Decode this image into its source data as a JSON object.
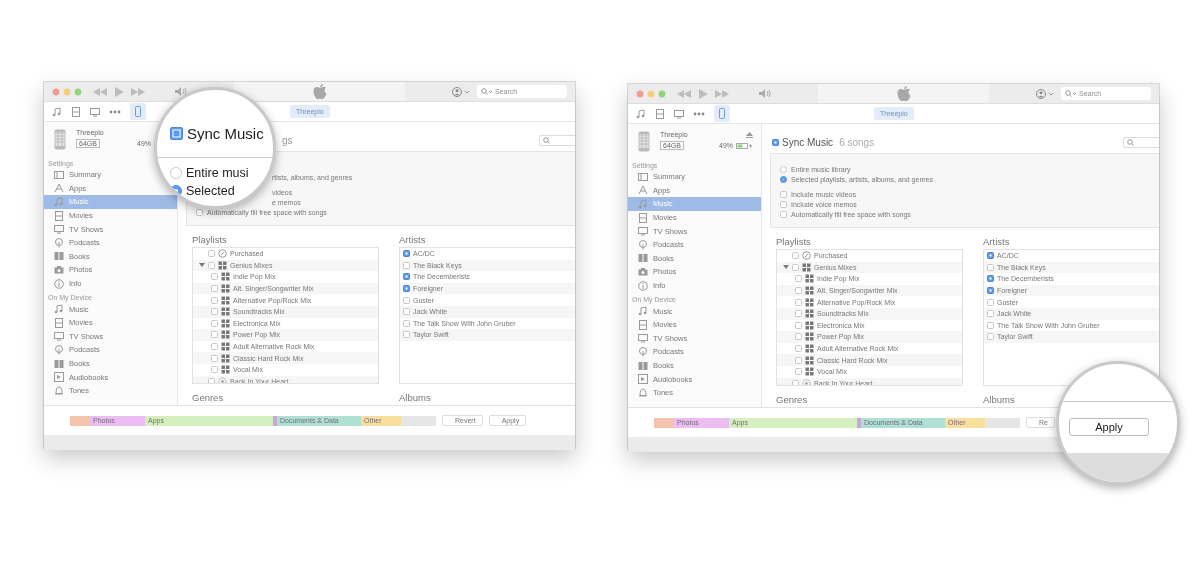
{
  "windows": [
    {
      "titlebar": {
        "search_placeholder": "Search"
      },
      "toolbar": {
        "device_tab": "Threepio"
      },
      "device": {
        "name": "Threepio",
        "capacity": "64GB",
        "battery": "49%",
        "status_icons": false
      },
      "sidebar": {
        "sections": [
          {
            "title": "Settings",
            "items": [
              {
                "label": "Summary",
                "kind": "summary",
                "selected": false
              },
              {
                "label": "Apps",
                "kind": "apps",
                "selected": false
              },
              {
                "label": "Music",
                "kind": "music",
                "selected": true
              },
              {
                "label": "Movies",
                "kind": "movies",
                "selected": false
              },
              {
                "label": "TV Shows",
                "kind": "tv",
                "selected": false
              },
              {
                "label": "Podcasts",
                "kind": "podcasts",
                "selected": false
              },
              {
                "label": "Books",
                "kind": "books",
                "selected": false
              },
              {
                "label": "Photos",
                "kind": "photos",
                "selected": false
              },
              {
                "label": "Info",
                "kind": "info",
                "selected": false
              }
            ]
          },
          {
            "title": "On My Device",
            "items": [
              {
                "label": "Music",
                "kind": "music",
                "selected": false
              },
              {
                "label": "Movies",
                "kind": "movies",
                "selected": false
              },
              {
                "label": "TV Shows",
                "kind": "tv",
                "selected": false
              },
              {
                "label": "Podcasts",
                "kind": "podcasts",
                "selected": false
              },
              {
                "label": "Books",
                "kind": "books",
                "selected": false
              },
              {
                "label": "Audiobooks",
                "kind": "audiobooks",
                "selected": false
              },
              {
                "label": "Tones",
                "kind": "tones",
                "selected": false
              }
            ]
          }
        ]
      },
      "sync": {
        "kind": "covered",
        "title": "gs"
      },
      "options": [
        {
          "kind": "covered"
        },
        {
          "kind": "covered",
          "label": "rtists, albums, and genres"
        },
        {
          "kind": "covered",
          "label": "videos"
        },
        {
          "kind": "covered",
          "label": "e memos"
        },
        {
          "kind": "checkbox",
          "label": "Automatically fill free space with songs",
          "checked": false
        }
      ],
      "playlists": {
        "title": "Playlists",
        "items": [
          {
            "label": "Purchased",
            "kind": "purchased",
            "checked": false
          },
          {
            "label": "Genius Mixes",
            "kind": "genius",
            "checked": false,
            "expanded": true,
            "children": [
              {
                "label": "Indie Pop Mix",
                "kind": "genius",
                "checked": false
              },
              {
                "label": "Alt. Singer/Songwriter Mix",
                "kind": "genius",
                "checked": false
              },
              {
                "label": "Alternative Pop/Rock Mix",
                "kind": "genius",
                "checked": false
              },
              {
                "label": "Soundtracks Mix",
                "kind": "genius",
                "checked": false
              },
              {
                "label": "Electronica Mix",
                "kind": "genius",
                "checked": false
              },
              {
                "label": "Power Pop Mix",
                "kind": "genius",
                "checked": false
              },
              {
                "label": "Adult Alternative Rock Mix",
                "kind": "genius",
                "checked": false
              },
              {
                "label": "Classic Hard Rock Mix",
                "kind": "genius",
                "checked": false
              },
              {
                "label": "Vocal Mix",
                "kind": "genius",
                "checked": false
              }
            ]
          },
          {
            "label": "Back In Your Heart",
            "kind": "smart",
            "checked": false
          }
        ]
      },
      "artists": {
        "title": "Artists",
        "items": [
          {
            "label": "AC/DC",
            "checked": true
          },
          {
            "label": "The Black Keys",
            "checked": false
          },
          {
            "label": "The Decemberists",
            "checked": true
          },
          {
            "label": "Foreigner",
            "checked": true
          },
          {
            "label": "Guster",
            "checked": false
          },
          {
            "label": "Jack White",
            "checked": false
          },
          {
            "label": "The Talk Show With John Gruber",
            "checked": false
          },
          {
            "label": "Taylor Swift",
            "checked": false
          }
        ]
      },
      "sections_below": [
        "Genres",
        "Albums"
      ],
      "capacity": [
        {
          "color": "#f3c4ab"
        },
        {
          "label": "Photos",
          "color": "#ebbdf2"
        },
        {
          "label": "Apps",
          "color": "#d5efbf"
        },
        {
          "color": "#c7a6d8"
        },
        {
          "label": "Documents & Data",
          "color": "#aee0d4"
        },
        {
          "label": "Other",
          "color": "#f9df9e"
        },
        {
          "color": "#e6e6e6"
        }
      ],
      "buttons": [
        "Revert",
        "Apply"
      ],
      "magnifier": {
        "kind": "sync",
        "checkbox": {
          "label": "Sync Music",
          "checked": true
        },
        "radios": [
          {
            "label": "Entire musi",
            "selected": false
          },
          {
            "label": "Selected",
            "selected": true
          }
        ]
      }
    },
    {
      "titlebar": {
        "search_placeholder": "Search"
      },
      "toolbar": {
        "device_tab": "Threepio"
      },
      "device": {
        "name": "Threepio",
        "capacity": "64GB",
        "battery": "49%",
        "status_icons": true
      },
      "sidebar": {
        "sections": [
          {
            "title": "Settings",
            "items": [
              {
                "label": "Summary",
                "kind": "summary",
                "selected": false
              },
              {
                "label": "Apps",
                "kind": "apps",
                "selected": false
              },
              {
                "label": "Music",
                "kind": "music",
                "selected": true
              },
              {
                "label": "Movies",
                "kind": "movies",
                "selected": false
              },
              {
                "label": "TV Shows",
                "kind": "tv",
                "selected": false
              },
              {
                "label": "Podcasts",
                "kind": "podcasts",
                "selected": false
              },
              {
                "label": "Books",
                "kind": "books",
                "selected": false
              },
              {
                "label": "Photos",
                "kind": "photos",
                "selected": false
              },
              {
                "label": "Info",
                "kind": "info",
                "selected": false
              }
            ]
          },
          {
            "title": "On My Device",
            "items": [
              {
                "label": "Music",
                "kind": "music",
                "selected": false
              },
              {
                "label": "Movies",
                "kind": "movies",
                "selected": false
              },
              {
                "label": "TV Shows",
                "kind": "tv",
                "selected": false
              },
              {
                "label": "Podcasts",
                "kind": "podcasts",
                "selected": false
              },
              {
                "label": "Books",
                "kind": "books",
                "selected": false
              },
              {
                "label": "Audiobooks",
                "kind": "audiobooks",
                "selected": false
              },
              {
                "label": "Tones",
                "kind": "tones",
                "selected": false
              }
            ]
          }
        ]
      },
      "sync": {
        "kind": "full",
        "title": "Sync Music",
        "count": "6 songs",
        "checked": true
      },
      "options": [
        {
          "kind": "radio",
          "label": "Entire music library",
          "selected": false
        },
        {
          "kind": "radio",
          "label": "Selected playlists, artists, albums, and genres",
          "selected": true
        },
        {
          "kind": "checkbox",
          "label": "Include music videos",
          "checked": false
        },
        {
          "kind": "checkbox",
          "label": "Include voice memos",
          "checked": false
        },
        {
          "kind": "checkbox",
          "label": "Automatically fill free space with songs",
          "checked": false
        }
      ],
      "playlists": {
        "title": "Playlists",
        "items": [
          {
            "label": "Purchased",
            "kind": "purchased",
            "checked": false
          },
          {
            "label": "Genius Mixes",
            "kind": "genius",
            "checked": false,
            "expanded": true,
            "children": [
              {
                "label": "Indie Pop Mix",
                "kind": "genius",
                "checked": false
              },
              {
                "label": "Alt. Singer/Songwriter Mix",
                "kind": "genius",
                "checked": false
              },
              {
                "label": "Alternative Pop/Rock Mix",
                "kind": "genius",
                "checked": false
              },
              {
                "label": "Soundtracks Mix",
                "kind": "genius",
                "checked": false
              },
              {
                "label": "Electronica Mix",
                "kind": "genius",
                "checked": false
              },
              {
                "label": "Power Pop Mix",
                "kind": "genius",
                "checked": false
              },
              {
                "label": "Adult Alternative Rock Mix",
                "kind": "genius",
                "checked": false
              },
              {
                "label": "Classic Hard Rock Mix",
                "kind": "genius",
                "checked": false
              },
              {
                "label": "Vocal Mix",
                "kind": "genius",
                "checked": false
              }
            ]
          },
          {
            "label": "Back In Your Heart",
            "kind": "smart",
            "checked": false
          }
        ]
      },
      "artists": {
        "title": "Artists",
        "items": [
          {
            "label": "AC/DC",
            "checked": true
          },
          {
            "label": "The Black Keys",
            "checked": false
          },
          {
            "label": "The Decemberists",
            "checked": true
          },
          {
            "label": "Foreigner",
            "checked": true
          },
          {
            "label": "Guster",
            "checked": false
          },
          {
            "label": "Jack White",
            "checked": false
          },
          {
            "label": "The Talk Show With John Gruber",
            "checked": false
          },
          {
            "label": "Taylor Swift",
            "checked": false
          }
        ]
      },
      "sections_below": [
        "Genres",
        "Albums"
      ],
      "capacity": [
        {
          "color": "#f3c4ab"
        },
        {
          "label": "Photos",
          "color": "#ebbdf2"
        },
        {
          "label": "Apps",
          "color": "#d5efbf"
        },
        {
          "color": "#c7a6d8"
        },
        {
          "label": "Documents & Data",
          "color": "#aee0d4"
        },
        {
          "label": "Other",
          "color": "#f9df9e"
        },
        {
          "color": "#e6e6e6"
        }
      ],
      "buttons": [
        "Re"
      ],
      "magnifier": {
        "kind": "apply",
        "label": "Apply"
      }
    }
  ]
}
